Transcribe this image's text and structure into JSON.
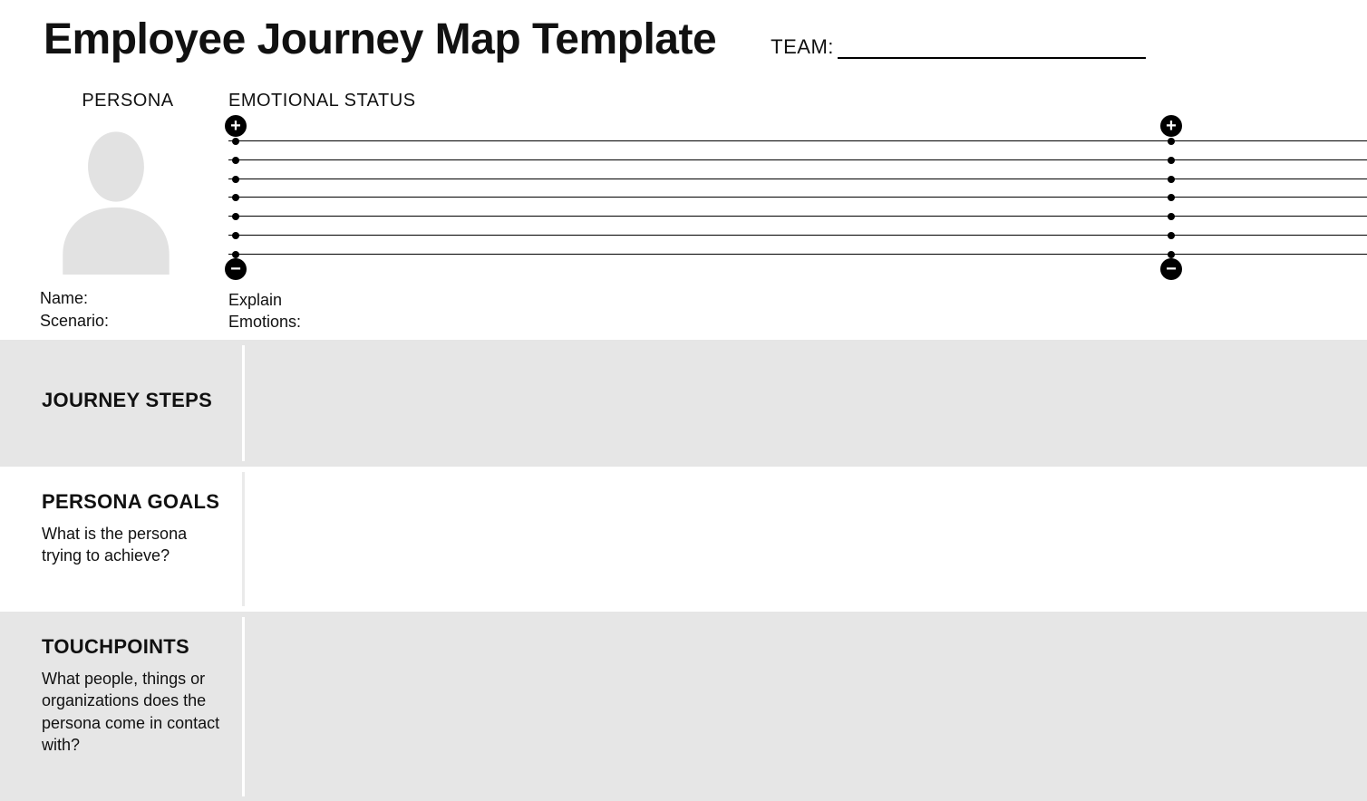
{
  "header": {
    "title": "Employee Journey Map Template",
    "team_label": "TEAM:",
    "team_value": ""
  },
  "persona": {
    "section_label": "PERSONA",
    "name_label": "Name:",
    "name_value": "",
    "scenario_label": "Scenario:",
    "scenario_value": ""
  },
  "emotional": {
    "section_label": "EMOTIONAL STATUS",
    "plus_symbol": "+",
    "minus_symbol": "−",
    "grid_line_count": 7,
    "explain_label_line1": "Explain",
    "explain_label_line2": "Emotions:",
    "explain_value": ""
  },
  "bands": {
    "journey_steps": {
      "title": "JOURNEY STEPS",
      "desc": ""
    },
    "persona_goals": {
      "title": "PERSONA GOALS",
      "desc": "What is the persona trying to achieve?"
    },
    "touchpoints": {
      "title": "TOUCHPOINTS",
      "desc": "What people, things or organizations does the persona come in contact with?"
    }
  }
}
